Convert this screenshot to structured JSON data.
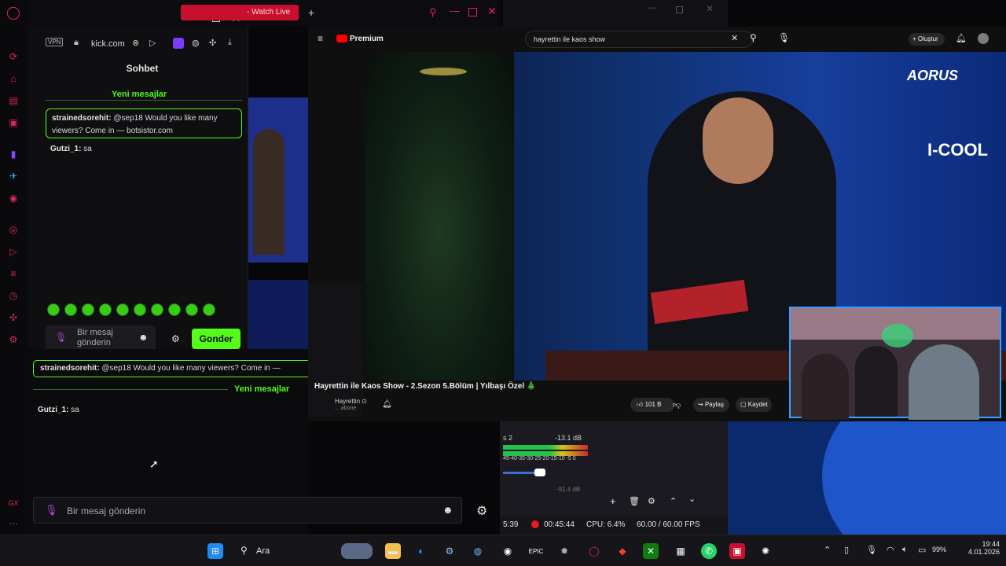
{
  "opera_tab": {
    "title": "- Watch Live",
    "plus": "+"
  },
  "kick": {
    "url": "kick.com",
    "chat_title": "Sohbet",
    "new_messages_label": "Yeni mesajlar",
    "message1": {
      "user": "strainedsorehit:",
      "text": " @sep18 Would you like many viewers? Come in — botsistor.com"
    },
    "message2": {
      "user": "Gutzi_1:",
      "text": " sa"
    },
    "input_placeholder": "Bir mesaj gönderin",
    "send_label": "Gonder"
  },
  "main_chat": {
    "message1": {
      "user": "strainedsorehit:",
      "text": " @sep18 Would you like many viewers? Come in —"
    },
    "new_messages_label": "Yeni mesajlar",
    "message2": {
      "user": "Gutzi_1:",
      "text": " sa"
    },
    "input_placeholder": "Bir mesaj gönderin"
  },
  "youtube": {
    "brand": "Premium",
    "search_value": "hayrettin ile kaos show",
    "create_label": "Oluştur",
    "video_title": "Hayrettin ile Kaos Show - 2.Sezon 5.Bölüm | Yılbaşı Özel 🎄",
    "channel": "Hayrettin",
    "subscribers": "... abone",
    "likes": "101 B",
    "share_label": "Paylaş",
    "save_label": "Kaydet",
    "overlay_brand1": "AORUS",
    "overlay_brand2": "I-COOL"
  },
  "obs": {
    "channel_label": "s 2",
    "db_label": "-13.1 dB",
    "scale": "45-40-35-30-25-20-15-10 -5 0",
    "time_left": "5:39",
    "rec_time": "00:45:44",
    "cpu": "CPU: 6.4%",
    "fps": "60.00 / 60.00 FPS",
    "db_label2": "-91.4 dB"
  },
  "taskbar": {
    "search_label": "Ara",
    "battery": "99%",
    "time": "19:44",
    "date": "4.01.2026"
  },
  "colors": {
    "kick_green": "#53fc18",
    "opera_red": "#e0245a",
    "youtube_red": "#ff0000"
  }
}
